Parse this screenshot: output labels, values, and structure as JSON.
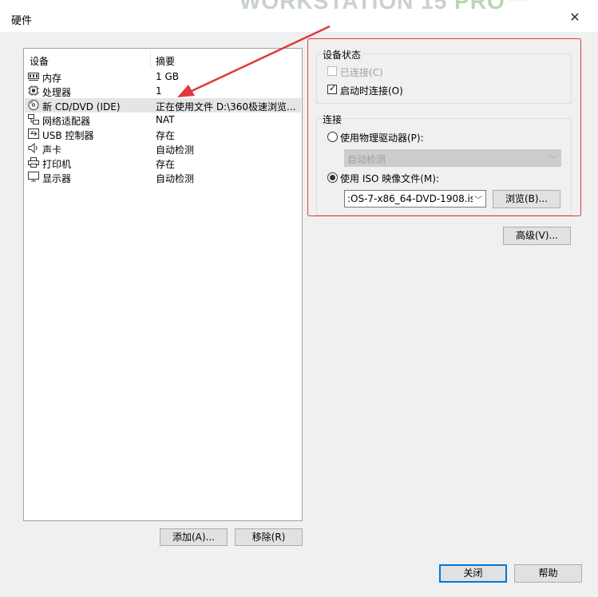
{
  "window": {
    "title": "硬件",
    "watermark_main": "WORKSTATION 15 ",
    "watermark_pro": "PRO™"
  },
  "device_list": {
    "col_device": "设备",
    "col_summary": "摘要",
    "rows": [
      {
        "name": "内存",
        "summary": "1 GB",
        "icon": "memory-icon"
      },
      {
        "name": "处理器",
        "summary": "1",
        "icon": "cpu-icon"
      },
      {
        "name": "新 CD/DVD (IDE)",
        "summary": "正在使用文件 D:\\360极速浏览...",
        "icon": "cd-icon"
      },
      {
        "name": "网络适配器",
        "summary": "NAT",
        "icon": "network-icon"
      },
      {
        "name": "USB 控制器",
        "summary": "存在",
        "icon": "usb-icon"
      },
      {
        "name": "声卡",
        "summary": "自动检测",
        "icon": "speaker-icon"
      },
      {
        "name": "打印机",
        "summary": "存在",
        "icon": "printer-icon"
      },
      {
        "name": "显示器",
        "summary": "自动检测",
        "icon": "monitor-icon"
      }
    ],
    "selected_index": 2
  },
  "buttons": {
    "add": "添加(A)...",
    "remove": "移除(R)",
    "advanced": "高级(V)...",
    "browse": "浏览(B)...",
    "close": "关闭",
    "help": "帮助"
  },
  "device_status": {
    "title": "设备状态",
    "connected": "已连接(C)",
    "connected_checked": false,
    "connect_on_start": "启动时连接(O)",
    "connect_on_start_checked": true
  },
  "connection": {
    "title": "连接",
    "physical": "使用物理驱动器(P):",
    "physical_value": "自动检测",
    "iso": "使用 ISO 映像文件(M):",
    "iso_value": ":OS-7-x86_64-DVD-1908.iso",
    "selected": "iso"
  },
  "colors": {
    "highlight_border": "#e0393a",
    "arrow": "#e0393a",
    "primary_button_border": "#0078d7"
  }
}
